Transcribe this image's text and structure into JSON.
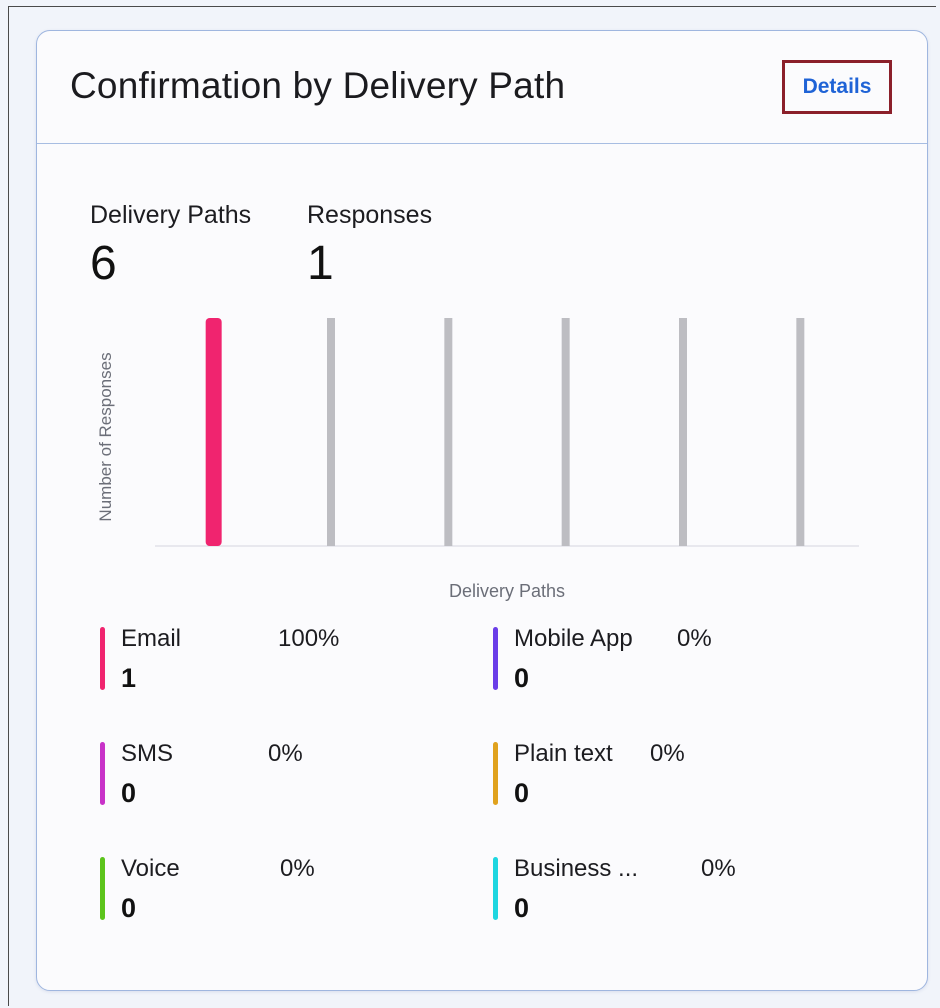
{
  "card": {
    "title": "Confirmation by Delivery Path",
    "details_label": "Details"
  },
  "stats": {
    "delivery_paths_label": "Delivery Paths",
    "delivery_paths_value": "6",
    "responses_label": "Responses",
    "responses_value": "1"
  },
  "legend": [
    {
      "name": "Email",
      "percent": "100%",
      "count": "1",
      "color": "#f0246f"
    },
    {
      "name": "Mobile App",
      "percent": "0%",
      "count": "0",
      "color": "#6a3de8"
    },
    {
      "name": "SMS",
      "percent": "0%",
      "count": "0",
      "color": "#c832c8"
    },
    {
      "name": "Plain text",
      "percent": "0%",
      "count": "0",
      "color": "#e0a21e"
    },
    {
      "name": "Voice",
      "percent": "0%",
      "count": "0",
      "color": "#5cc41c"
    },
    {
      "name": "Business ...",
      "percent": "0%",
      "count": "0",
      "color": "#1ed6e0"
    }
  ],
  "chart_data": {
    "type": "bar",
    "xlabel": "Delivery Paths",
    "ylabel": "Number of Responses",
    "categories": [
      "Email",
      "Mobile App",
      "SMS",
      "Plain text",
      "Voice",
      "Business ..."
    ],
    "values": [
      1,
      0,
      0,
      0,
      0,
      0
    ],
    "ylim": [
      0,
      1
    ],
    "highlight_color": "#f0246f",
    "empty_color": "#bdbdc2",
    "grid": false
  }
}
